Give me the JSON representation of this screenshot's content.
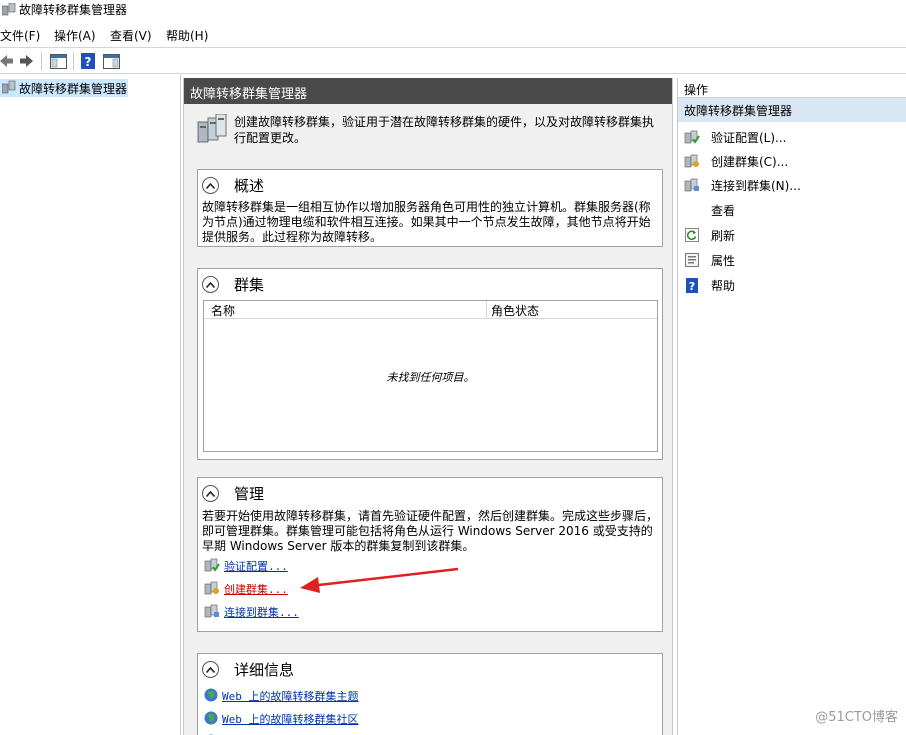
{
  "window": {
    "title": "故障转移群集管理器"
  },
  "menu": {
    "items": [
      "文件(F)",
      "操作(A)",
      "查看(V)",
      "帮助(H)"
    ]
  },
  "tree": {
    "root_label": "故障转移群集管理器"
  },
  "center": {
    "header": "故障转移群集管理器",
    "intro_text": "创建故障转移群集，验证用于潜在故障转移群集的硬件，以及对故障转移群集执行配置更改。",
    "overview": {
      "title": "概述",
      "body": "故障转移群集是一组相互协作以增加服务器角色可用性的独立计算机。群集服务器(称为节点)通过物理电缆和软件相互连接。如果其中一个节点发生故障，其他节点将开始提供服务。此过程称为故障转移。"
    },
    "clusters": {
      "title": "群集",
      "columns": [
        "名称",
        "角色状态"
      ],
      "empty_text": "未找到任何项目。"
    },
    "management": {
      "title": "管理",
      "body": "若要开始使用故障转移群集，请首先验证硬件配置，然后创建群集。完成这些步骤后，即可管理群集。群集管理可能包括将角色从运行 Windows Server 2016 或受支持的早期 Windows Server 版本的群集复制到该群集。",
      "links": [
        "验证配置...",
        "创建群集...",
        "连接到群集..."
      ]
    },
    "details": {
      "title": "详细信息",
      "links": [
        "Web 上的故障转移群集主题",
        "Web 上的故障转移群集社区"
      ]
    }
  },
  "actions": {
    "title": "操作",
    "group_label": "故障转移群集管理器",
    "items": [
      "验证配置(L)...",
      "创建群集(C)...",
      "连接到群集(N)...",
      "查看",
      "刷新",
      "属性",
      "帮助"
    ]
  },
  "watermark": "@51CTO博客",
  "colors": {
    "header_bg": "#4a4a4a",
    "selection": "#cce8ff",
    "action_group": "#d9e6f4",
    "link": "#0033aa",
    "highlight_red": "#cc0000"
  }
}
